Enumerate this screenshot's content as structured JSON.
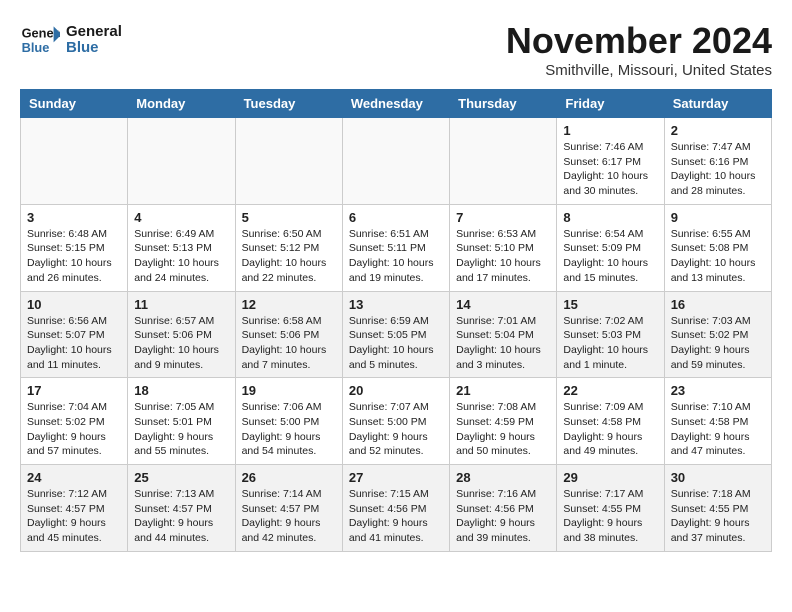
{
  "logo": {
    "line1": "General",
    "line2": "Blue"
  },
  "title": "November 2024",
  "location": "Smithville, Missouri, United States",
  "days_header": [
    "Sunday",
    "Monday",
    "Tuesday",
    "Wednesday",
    "Thursday",
    "Friday",
    "Saturday"
  ],
  "weeks": [
    [
      {
        "day": "",
        "info": "",
        "empty": true
      },
      {
        "day": "",
        "info": "",
        "empty": true
      },
      {
        "day": "",
        "info": "",
        "empty": true
      },
      {
        "day": "",
        "info": "",
        "empty": true
      },
      {
        "day": "",
        "info": "",
        "empty": true
      },
      {
        "day": "1",
        "info": "Sunrise: 7:46 AM\nSunset: 6:17 PM\nDaylight: 10 hours\nand 30 minutes."
      },
      {
        "day": "2",
        "info": "Sunrise: 7:47 AM\nSunset: 6:16 PM\nDaylight: 10 hours\nand 28 minutes."
      }
    ],
    [
      {
        "day": "3",
        "info": "Sunrise: 6:48 AM\nSunset: 5:15 PM\nDaylight: 10 hours\nand 26 minutes."
      },
      {
        "day": "4",
        "info": "Sunrise: 6:49 AM\nSunset: 5:13 PM\nDaylight: 10 hours\nand 24 minutes."
      },
      {
        "day": "5",
        "info": "Sunrise: 6:50 AM\nSunset: 5:12 PM\nDaylight: 10 hours\nand 22 minutes."
      },
      {
        "day": "6",
        "info": "Sunrise: 6:51 AM\nSunset: 5:11 PM\nDaylight: 10 hours\nand 19 minutes."
      },
      {
        "day": "7",
        "info": "Sunrise: 6:53 AM\nSunset: 5:10 PM\nDaylight: 10 hours\nand 17 minutes."
      },
      {
        "day": "8",
        "info": "Sunrise: 6:54 AM\nSunset: 5:09 PM\nDaylight: 10 hours\nand 15 minutes."
      },
      {
        "day": "9",
        "info": "Sunrise: 6:55 AM\nSunset: 5:08 PM\nDaylight: 10 hours\nand 13 minutes."
      }
    ],
    [
      {
        "day": "10",
        "info": "Sunrise: 6:56 AM\nSunset: 5:07 PM\nDaylight: 10 hours\nand 11 minutes."
      },
      {
        "day": "11",
        "info": "Sunrise: 6:57 AM\nSunset: 5:06 PM\nDaylight: 10 hours\nand 9 minutes."
      },
      {
        "day": "12",
        "info": "Sunrise: 6:58 AM\nSunset: 5:06 PM\nDaylight: 10 hours\nand 7 minutes."
      },
      {
        "day": "13",
        "info": "Sunrise: 6:59 AM\nSunset: 5:05 PM\nDaylight: 10 hours\nand 5 minutes."
      },
      {
        "day": "14",
        "info": "Sunrise: 7:01 AM\nSunset: 5:04 PM\nDaylight: 10 hours\nand 3 minutes."
      },
      {
        "day": "15",
        "info": "Sunrise: 7:02 AM\nSunset: 5:03 PM\nDaylight: 10 hours\nand 1 minute."
      },
      {
        "day": "16",
        "info": "Sunrise: 7:03 AM\nSunset: 5:02 PM\nDaylight: 9 hours\nand 59 minutes."
      }
    ],
    [
      {
        "day": "17",
        "info": "Sunrise: 7:04 AM\nSunset: 5:02 PM\nDaylight: 9 hours\nand 57 minutes."
      },
      {
        "day": "18",
        "info": "Sunrise: 7:05 AM\nSunset: 5:01 PM\nDaylight: 9 hours\nand 55 minutes."
      },
      {
        "day": "19",
        "info": "Sunrise: 7:06 AM\nSunset: 5:00 PM\nDaylight: 9 hours\nand 54 minutes."
      },
      {
        "day": "20",
        "info": "Sunrise: 7:07 AM\nSunset: 5:00 PM\nDaylight: 9 hours\nand 52 minutes."
      },
      {
        "day": "21",
        "info": "Sunrise: 7:08 AM\nSunset: 4:59 PM\nDaylight: 9 hours\nand 50 minutes."
      },
      {
        "day": "22",
        "info": "Sunrise: 7:09 AM\nSunset: 4:58 PM\nDaylight: 9 hours\nand 49 minutes."
      },
      {
        "day": "23",
        "info": "Sunrise: 7:10 AM\nSunset: 4:58 PM\nDaylight: 9 hours\nand 47 minutes."
      }
    ],
    [
      {
        "day": "24",
        "info": "Sunrise: 7:12 AM\nSunset: 4:57 PM\nDaylight: 9 hours\nand 45 minutes."
      },
      {
        "day": "25",
        "info": "Sunrise: 7:13 AM\nSunset: 4:57 PM\nDaylight: 9 hours\nand 44 minutes."
      },
      {
        "day": "26",
        "info": "Sunrise: 7:14 AM\nSunset: 4:57 PM\nDaylight: 9 hours\nand 42 minutes."
      },
      {
        "day": "27",
        "info": "Sunrise: 7:15 AM\nSunset: 4:56 PM\nDaylight: 9 hours\nand 41 minutes."
      },
      {
        "day": "28",
        "info": "Sunrise: 7:16 AM\nSunset: 4:56 PM\nDaylight: 9 hours\nand 39 minutes."
      },
      {
        "day": "29",
        "info": "Sunrise: 7:17 AM\nSunset: 4:55 PM\nDaylight: 9 hours\nand 38 minutes."
      },
      {
        "day": "30",
        "info": "Sunrise: 7:18 AM\nSunset: 4:55 PM\nDaylight: 9 hours\nand 37 minutes."
      }
    ]
  ]
}
